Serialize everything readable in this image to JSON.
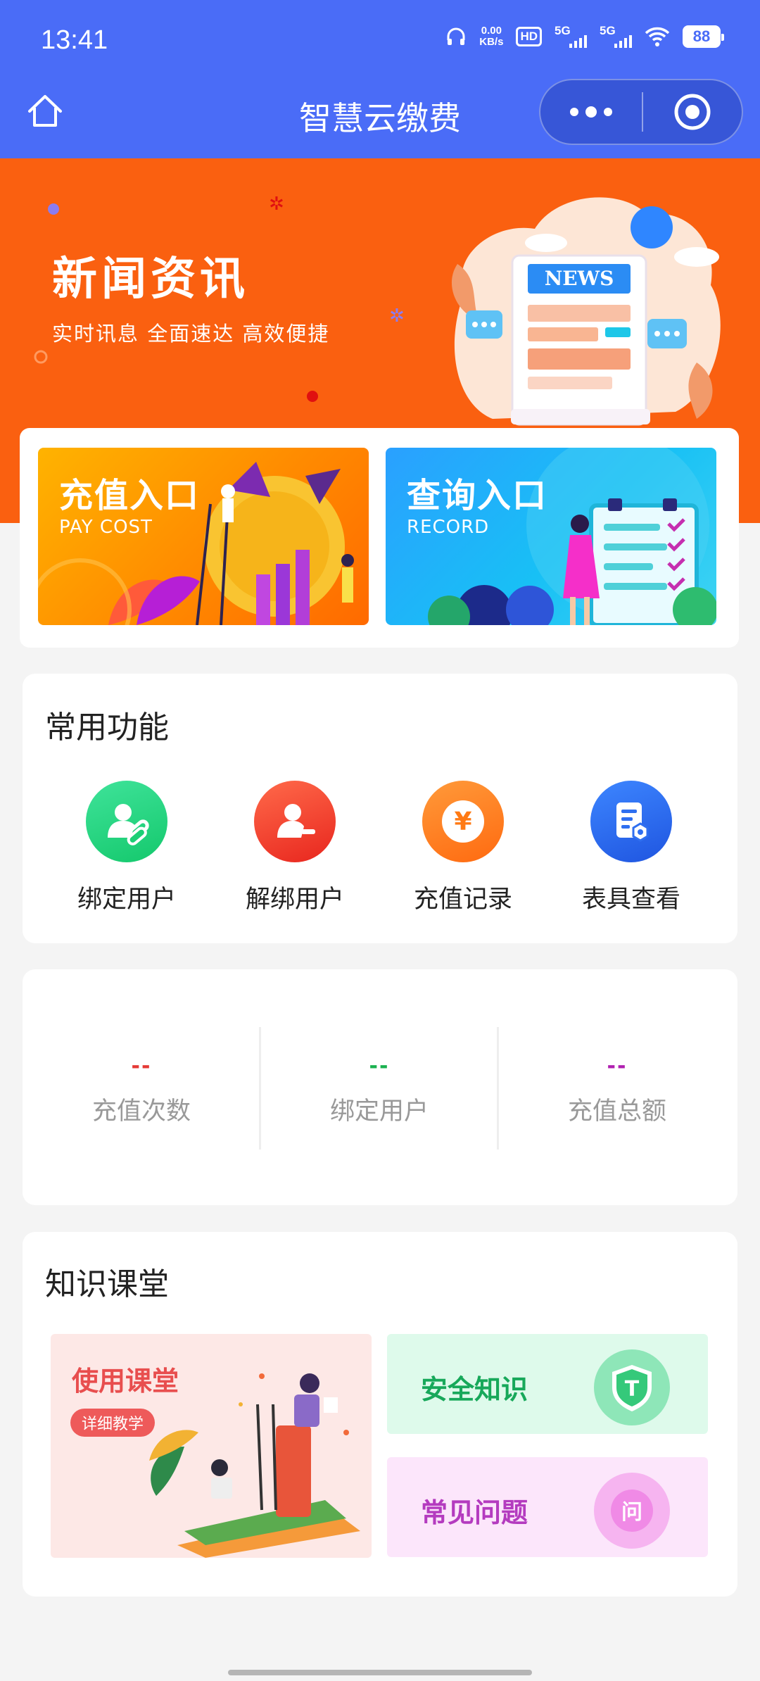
{
  "status_bar": {
    "time": "13:41",
    "speed_value": "0.00",
    "speed_unit": "KB/s",
    "hd_label": "HD",
    "signal1_label": "5G",
    "signal2_label": "5G",
    "battery": "88"
  },
  "nav": {
    "title": "智慧云缴费",
    "home_icon": "home-icon",
    "more_icon": "more-dots-icon",
    "close_icon": "target-close-icon"
  },
  "banner": {
    "title": "新闻资讯",
    "subtitle": "实时讯息  全面速达  高效便捷",
    "news_tag": "NEWS"
  },
  "entries": {
    "pay": {
      "title": "充值入口",
      "subtitle": "PAY COST"
    },
    "record": {
      "title": "查询入口",
      "subtitle": "RECORD"
    }
  },
  "functions": {
    "title": "常用功能",
    "items": [
      {
        "label": "绑定用户",
        "icon": "user-link-icon",
        "color": "#1fd27c"
      },
      {
        "label": "解绑用户",
        "icon": "user-remove-icon",
        "color": "#f44336"
      },
      {
        "label": "充值记录",
        "icon": "yen-coin-icon",
        "color": "#ff7a14"
      },
      {
        "label": "表具查看",
        "icon": "meter-document-icon",
        "color": "#2f6ff0"
      }
    ]
  },
  "stats": [
    {
      "value": "--",
      "label": "充值次数",
      "color": "#e53935"
    },
    {
      "value": "--",
      "label": "绑定用户",
      "color": "#19b14f"
    },
    {
      "value": "--",
      "label": "充值总额",
      "color": "#b01fb0"
    }
  ],
  "knowledge": {
    "title": "知识课堂",
    "use": {
      "title": "使用课堂",
      "tag": "详细教学"
    },
    "safe": {
      "title": "安全知识",
      "badge": "T"
    },
    "faq": {
      "title": "常见问题",
      "badge": "问"
    }
  }
}
